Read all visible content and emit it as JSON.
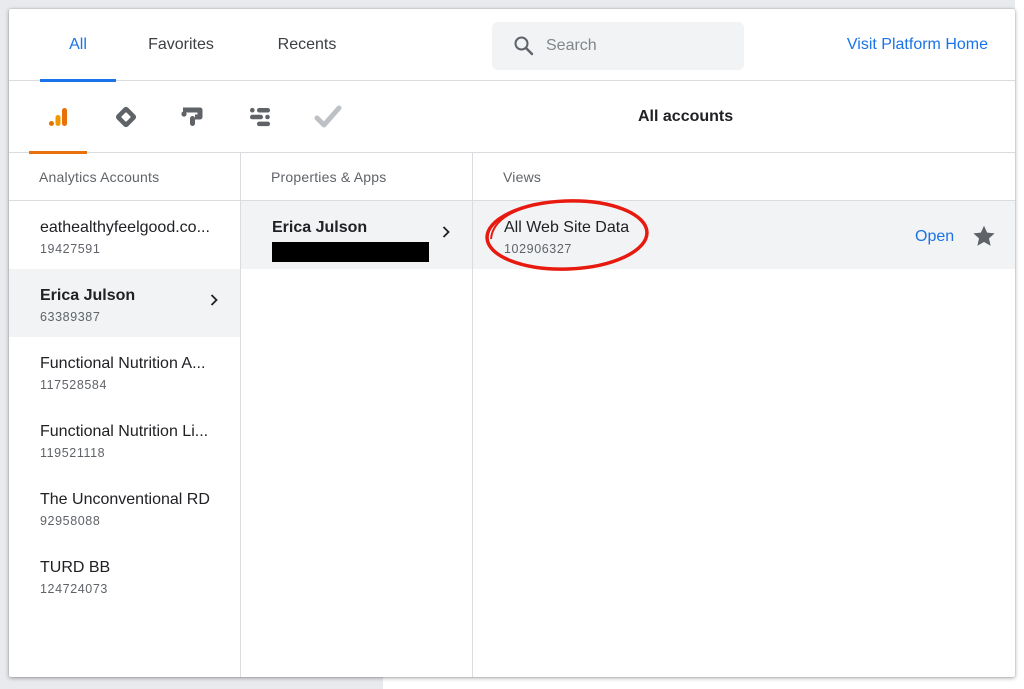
{
  "tabs": [
    {
      "label": "All",
      "active": true
    },
    {
      "label": "Favorites",
      "active": false
    },
    {
      "label": "Recents",
      "active": false
    }
  ],
  "search": {
    "placeholder": "Search"
  },
  "visit_link": "Visit Platform Home",
  "products": [
    {
      "icon": "analytics-icon",
      "color": "#e8710a",
      "active": true
    },
    {
      "icon": "tag-manager-icon",
      "color": "#5f6368",
      "active": false
    },
    {
      "icon": "optimize-icon",
      "color": "#5f6368",
      "active": false
    },
    {
      "icon": "data-studio-icon",
      "color": "#5f6368",
      "active": false
    },
    {
      "icon": "surveys-check-icon",
      "color": "#bdc1c6",
      "active": false
    }
  ],
  "scope_title": "All accounts",
  "columns": {
    "accounts_header": "Analytics Accounts",
    "properties_header": "Properties & Apps",
    "views_header": "Views"
  },
  "accounts": [
    {
      "name": "eathealthyfeelgood.co...",
      "id": "19427591",
      "selected": false
    },
    {
      "name": "Erica Julson",
      "id": "63389387",
      "selected": true
    },
    {
      "name": "Functional Nutrition A...",
      "id": "117528584",
      "selected": false
    },
    {
      "name": "Functional Nutrition Li...",
      "id": "119521118",
      "selected": false
    },
    {
      "name": "The Unconventional RD",
      "id": "92958088",
      "selected": false
    },
    {
      "name": "TURD BB",
      "id": "124724073",
      "selected": false
    }
  ],
  "properties": [
    {
      "name": "Erica Julson",
      "id_redacted": true,
      "selected": true
    }
  ],
  "views": [
    {
      "name": "All Web Site Data",
      "id": "102906327",
      "action": "Open",
      "circled": true
    }
  ],
  "colors": {
    "accent": "#1a73e8",
    "analytics_orange": "#e8710a",
    "annotation_red": "#e8190f"
  }
}
